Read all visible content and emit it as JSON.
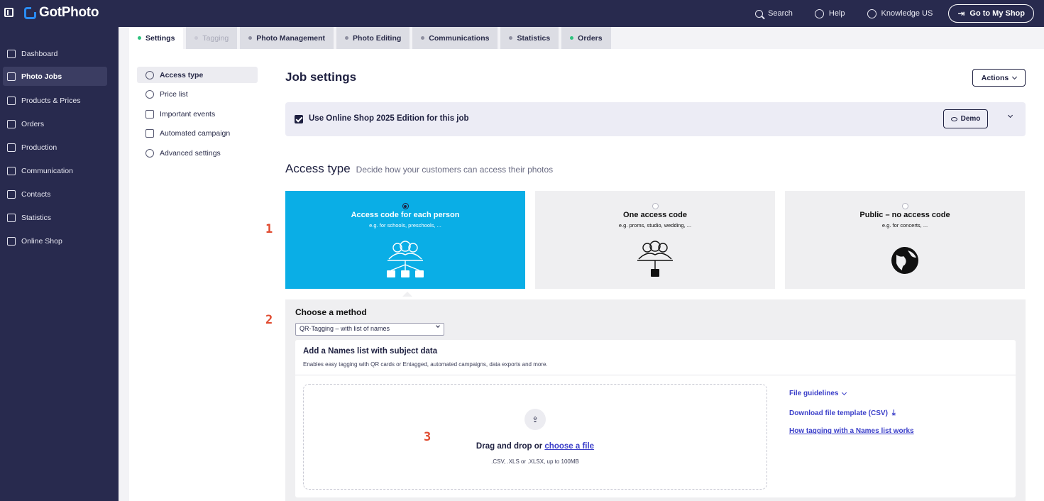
{
  "app": {
    "name": "GotPhoto"
  },
  "topbar": {
    "search_label": "Search",
    "help_label": "Help",
    "knowledge_label": "Knowledge US",
    "shop_button_label": "Go to My Shop"
  },
  "sidebar": {
    "items": [
      {
        "label": "Dashboard",
        "icon": "home-icon"
      },
      {
        "label": "Photo Jobs",
        "icon": "image-icon",
        "active": true
      },
      {
        "label": "Products & Prices",
        "icon": "cart-icon"
      },
      {
        "label": "Orders",
        "icon": "orders-icon"
      },
      {
        "label": "Production",
        "icon": "printer-icon"
      },
      {
        "label": "Communication",
        "icon": "message-icon"
      },
      {
        "label": "Contacts",
        "icon": "person-icon"
      },
      {
        "label": "Statistics",
        "icon": "chart-icon"
      },
      {
        "label": "Online Shop",
        "icon": "store-icon"
      }
    ]
  },
  "tabs": [
    {
      "label": "Settings",
      "state": "active"
    },
    {
      "label": "Tagging",
      "state": "disabled"
    },
    {
      "label": "Photo Management",
      "state": "normal"
    },
    {
      "label": "Photo Editing",
      "state": "normal"
    },
    {
      "label": "Communications",
      "state": "normal"
    },
    {
      "label": "Statistics",
      "state": "normal"
    },
    {
      "label": "Orders",
      "state": "normal"
    }
  ],
  "subnav": {
    "items": [
      {
        "label": "Access type",
        "icon": "people-icon",
        "active": true
      },
      {
        "label": "Price list",
        "icon": "dollar-icon"
      },
      {
        "label": "Important events",
        "icon": "calendar-icon"
      },
      {
        "label": "Automated campaign",
        "icon": "megaphone-icon"
      },
      {
        "label": "Advanced settings",
        "icon": "gear-icon"
      }
    ]
  },
  "page": {
    "title": "Job settings",
    "actions_label": "Actions"
  },
  "banner": {
    "text": "Use Online Shop 2025 Edition for this job",
    "checked": true,
    "demo_label": "Demo"
  },
  "access_type": {
    "title": "Access type",
    "subtitle": "Decide how your customers can access their photos",
    "options": [
      {
        "title": "Access code for each person",
        "subtitle": "e.g. for schools, preschools, ...",
        "selected": true
      },
      {
        "title": "One access code",
        "subtitle": "e.g. proms, studio, wedding, ...",
        "selected": false
      },
      {
        "title": "Public – no access code",
        "subtitle": "e.g. for concerts, ...",
        "selected": false
      }
    ]
  },
  "method": {
    "title": "Choose a method",
    "selected": "QR-Tagging – with list of names"
  },
  "names_list": {
    "title": "Add a Names list with subject data",
    "subtitle": "Enables easy tagging with QR cards or Entagged, automated campaigns, data exports and more.",
    "drop_text": "Drag and drop or",
    "drop_link": "choose a file",
    "drop_hint": ".CSV, .XLS or .XLSX, up to 100MB",
    "links": {
      "guidelines": "File guidelines",
      "template": "Download file template (CSV)",
      "how_it_works": "How tagging with a Names list works"
    }
  },
  "markers": [
    "1",
    "2",
    "3"
  ],
  "colors": {
    "nav_bg": "#282a4e",
    "accent_blue": "#0aaee6",
    "link": "#3a3ec9",
    "marker_red": "#e04a2f",
    "status_green": "#2ec27e"
  }
}
